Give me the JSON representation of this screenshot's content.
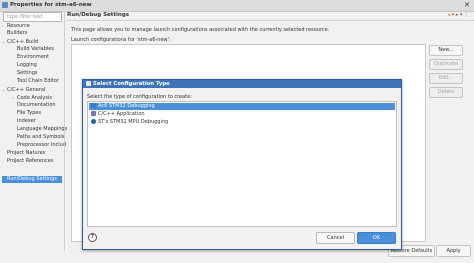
{
  "window": {
    "title": "Properties for stm-a6-new"
  },
  "filter": {
    "placeholder": "type filter text"
  },
  "tree": {
    "items": [
      {
        "label": "Resource",
        "expander": "›"
      },
      {
        "label": "Builders",
        "expander": ""
      },
      {
        "label": "C/C++ Build",
        "expander": "⌄"
      },
      {
        "label": "Build Variables",
        "expander": ""
      },
      {
        "label": "Environment",
        "expander": ""
      },
      {
        "label": "Logging",
        "expander": ""
      },
      {
        "label": "Settings",
        "expander": ""
      },
      {
        "label": "Tool Chain Editor",
        "expander": ""
      },
      {
        "label": "C/C++ General",
        "expander": "⌄"
      },
      {
        "label": "Code Analysis",
        "expander": "›"
      },
      {
        "label": "Documentation",
        "expander": ""
      },
      {
        "label": "File Types",
        "expander": ""
      },
      {
        "label": "Indexer",
        "expander": ""
      },
      {
        "label": "Language Mappings",
        "expander": ""
      },
      {
        "label": "Paths and Symbols",
        "expander": ""
      },
      {
        "label": "Preprocessor Includ",
        "expander": ""
      },
      {
        "label": "Project Natures",
        "expander": ""
      },
      {
        "label": "Project References",
        "expander": ""
      },
      {
        "label": "Run/Debug Settings",
        "expander": ""
      }
    ]
  },
  "page": {
    "title": "Run/Debug Settings",
    "description": "This page allows you to manage launch configurations associated with the currently selected resource.",
    "launch_label": "Launch configurations for 'stm-a6-new':"
  },
  "side_buttons": {
    "new": "New...",
    "duplicate": "Duplicate",
    "edit": "Edit...",
    "delete": "Delete"
  },
  "footer": {
    "restore_defaults": "Restore Defaults",
    "apply": "Apply"
  },
  "dialog": {
    "title": "Select Configuration Type",
    "prompt": "Select the type of configuration to create:",
    "types": [
      {
        "label": "Ac6 STM32 Debugging",
        "icon_color": "#2d7bd3"
      },
      {
        "label": "C/C++ Application",
        "icon_color": "#7a6fc2"
      },
      {
        "label": "ST's STM32 MPU Debugging",
        "icon_color": "#1d5fb0"
      }
    ],
    "help_symbol": "?",
    "cancel": "Cancel",
    "ok": "OK"
  },
  "colors": {
    "accent": "#4a90d9",
    "dialog_title_bg": "#3d74b8"
  }
}
